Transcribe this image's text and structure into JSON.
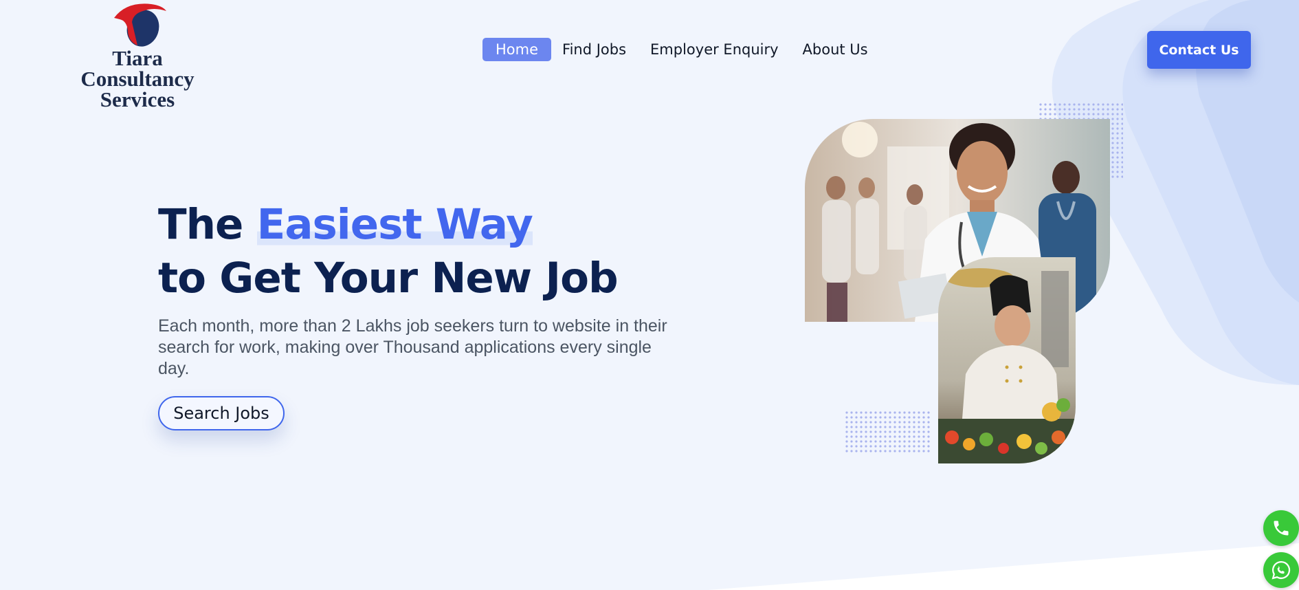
{
  "brand": {
    "name_line1": "Tiara Consultancy",
    "name_line2": "Services",
    "logo_icon": "tiara-logo-icon"
  },
  "nav": {
    "items": [
      {
        "label": "Home",
        "active": true
      },
      {
        "label": "Find Jobs",
        "active": false
      },
      {
        "label": "Employer Enquiry",
        "active": false
      },
      {
        "label": "About Us",
        "active": false
      }
    ],
    "contact_label": "Contact Us"
  },
  "hero": {
    "title_prefix": "The ",
    "title_highlight": "Easiest Way",
    "title_line2": "to Get Your New Job",
    "description": "Each month, more than 2 Lakhs job seekers turn to website in their search for work, making over Thousand applications every single day.",
    "search_button_label": "Search Jobs",
    "images": [
      "doctor-photo",
      "chef-photo"
    ]
  },
  "floating": {
    "call_icon": "phone-icon",
    "whatsapp_icon": "whatsapp-icon"
  },
  "colors": {
    "accent": "#3f66ec",
    "heading": "#0c2150",
    "nav_active_bg": "#6c86ef",
    "background": "#f1f5fd",
    "float_green": "#39c939"
  }
}
